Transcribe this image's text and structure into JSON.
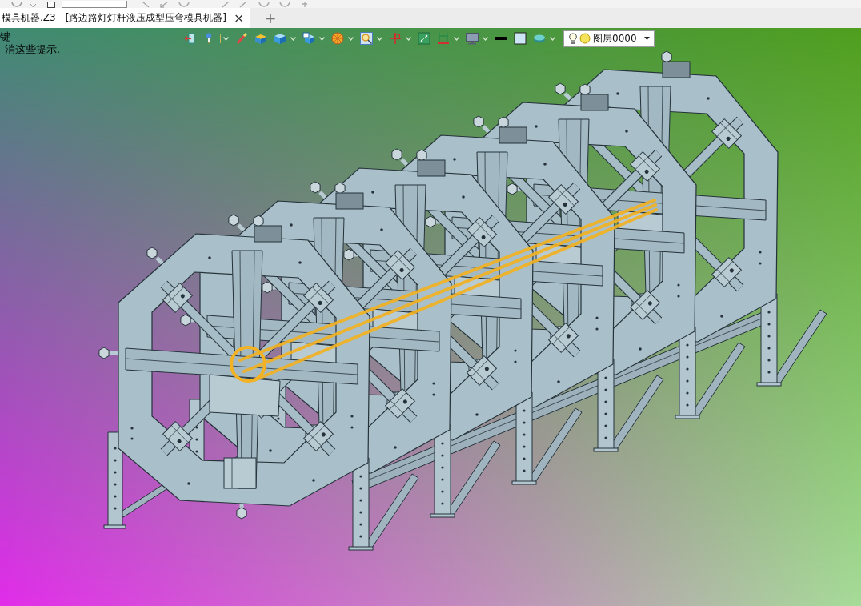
{
  "tabs": [
    {
      "label": "模具机器.Z3 - [路边路灯灯杆液压成型压弯模具机器]",
      "close": "×",
      "selected": true
    }
  ],
  "new_tab": "+",
  "hints": [
    "键",
    "消这些提示."
  ],
  "toolbar": {
    "tools": [
      {
        "kind": "exit",
        "dropdown": false
      },
      {
        "kind": "pin",
        "dropdown": true
      },
      {
        "kind": "brush",
        "dropdown": false
      },
      {
        "kind": "open-box",
        "dropdown": false
      },
      {
        "kind": "cube",
        "dropdown": true
      },
      {
        "kind": "view",
        "dropdown": true
      },
      {
        "kind": "sphere",
        "dropdown": true
      },
      {
        "kind": "zoom",
        "dropdown": true
      },
      {
        "kind": "axis",
        "dropdown": true
      },
      {
        "kind": "fit",
        "dropdown": false
      },
      {
        "kind": "frame",
        "dropdown": true
      },
      {
        "kind": "display",
        "dropdown": true
      },
      {
        "kind": "line",
        "dropdown": false
      },
      {
        "kind": "swatch",
        "dropdown": false
      },
      {
        "kind": "layers",
        "dropdown": true
      }
    ],
    "layer": {
      "value": "图层0000"
    }
  }
}
